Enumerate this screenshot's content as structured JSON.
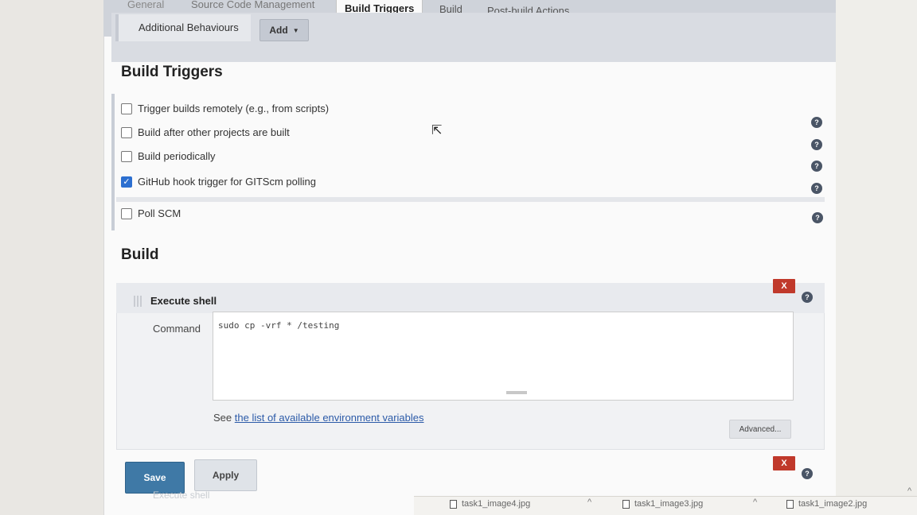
{
  "tabs": {
    "general": "General",
    "scm": "Source Code Management",
    "build_triggers": "Build Triggers",
    "build": "Build",
    "post_build": "Post-build Actions"
  },
  "scm": {
    "additional_behaviours": "Additional Behaviours",
    "add_button": "Add"
  },
  "triggers": {
    "title": "Build Triggers",
    "items": [
      {
        "label": "Trigger builds remotely (e.g., from scripts)",
        "checked": false
      },
      {
        "label": "Build after other projects are built",
        "checked": false
      },
      {
        "label": "Build periodically",
        "checked": false
      },
      {
        "label": "GitHub hook trigger for GITScm polling",
        "checked": true
      },
      {
        "label": "Poll SCM",
        "checked": false
      }
    ]
  },
  "build": {
    "title": "Build",
    "step_title": "Execute shell",
    "delete_label": "X",
    "command_label": "Command",
    "command_value": "sudo cp -vrf * /testing",
    "see_prefix": "See",
    "see_link": "the list of available environment variables",
    "advanced_button": "Advanced...",
    "ghost_step": "Execute shell"
  },
  "actions": {
    "save": "Save",
    "apply": "Apply"
  },
  "downloads": [
    {
      "name": "task1_image4.jpg"
    },
    {
      "name": "task1_image3.jpg"
    },
    {
      "name": "task1_image2.jpg"
    }
  ],
  "colors": {
    "primary_button": "#3f79a6",
    "delete_button": "#c0392b",
    "checkbox_checked": "#2c6fd0",
    "link": "#2b5aa8"
  },
  "icons": {
    "help": "question-circle",
    "dropdown": "caret-down",
    "cursor": "arrow-pointer",
    "file": "image-file",
    "chevron": "chevron-up"
  }
}
